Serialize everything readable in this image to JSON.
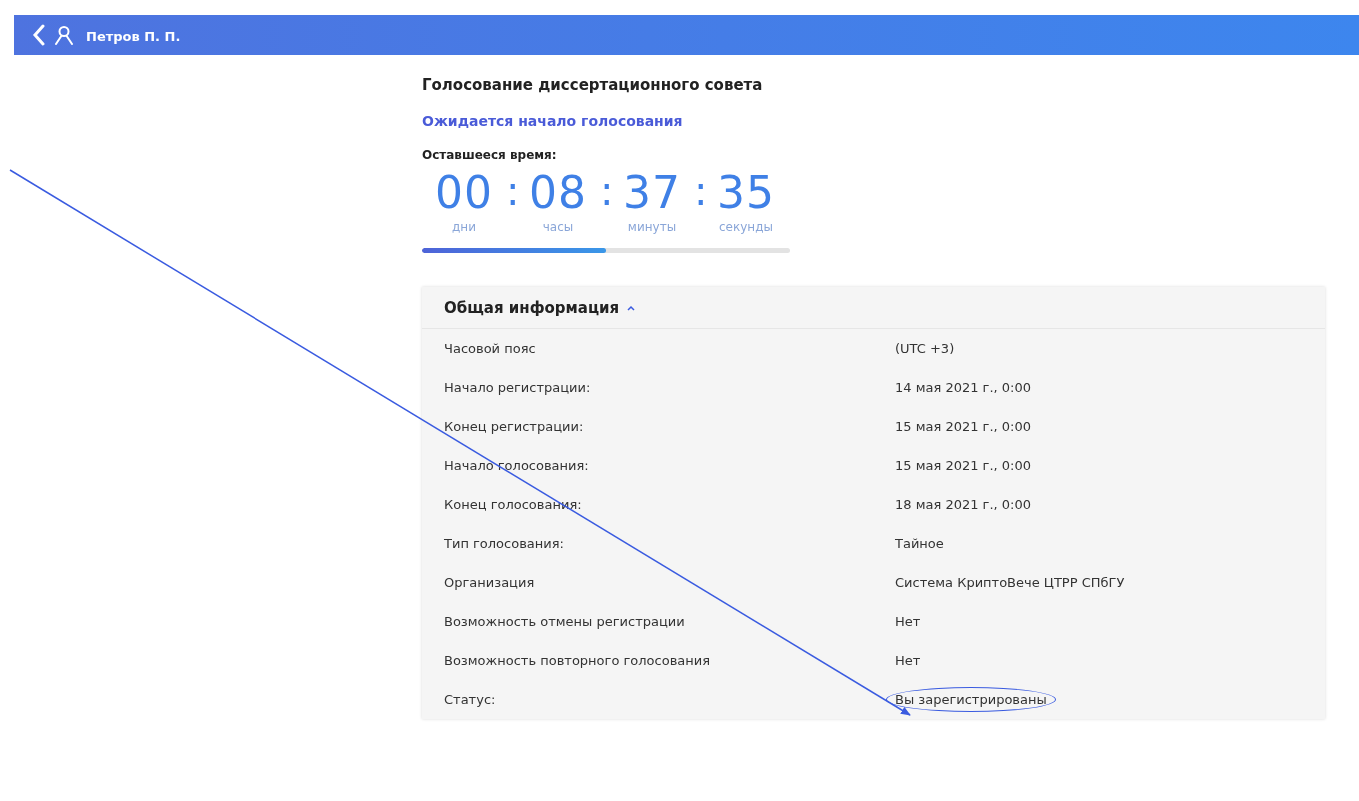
{
  "header": {
    "user_name": "Петров П. П."
  },
  "title": "Голосование диссертационного совета",
  "status_link": "Ожидается начало голосования",
  "timer": {
    "label": "Оставшееся время:",
    "separator": ":",
    "segments": [
      {
        "value": "00",
        "unit": "дни"
      },
      {
        "value": "08",
        "unit": "часы"
      },
      {
        "value": "37",
        "unit": "минуты"
      },
      {
        "value": "35",
        "unit": "секунды"
      }
    ],
    "level": 0.5
  },
  "info": {
    "title": "Общая информация",
    "expanded": true,
    "rows": [
      {
        "label": "Часовой пояс",
        "value": "(UTC +3)",
        "highlighted": false
      },
      {
        "label": "Начало регистрации:",
        "value": "14 мая 2021 г., 0:00",
        "highlighted": false
      },
      {
        "label": "Конец регистрации:",
        "value": "15 мая 2021 г., 0:00",
        "highlighted": false
      },
      {
        "label": "Начало голосования:",
        "value": "15 мая 2021 г., 0:00",
        "highlighted": false
      },
      {
        "label": "Конец голосования:",
        "value": "18 мая 2021 г., 0:00",
        "highlighted": false
      },
      {
        "label": "Тип голосования:",
        "value": "Тайное",
        "highlighted": false
      },
      {
        "label": "Организация",
        "value": "Система КриптоВече ЦТРР СПбГУ",
        "highlighted": false
      },
      {
        "label": "Возможность отмены регистрации",
        "value": "Нет",
        "highlighted": false
      },
      {
        "label": "Возможность повторного голосования",
        "value": "Нет",
        "highlighted": false
      },
      {
        "label": "Статус:",
        "value": "Вы зарегистрированы",
        "highlighted": true
      }
    ]
  }
}
